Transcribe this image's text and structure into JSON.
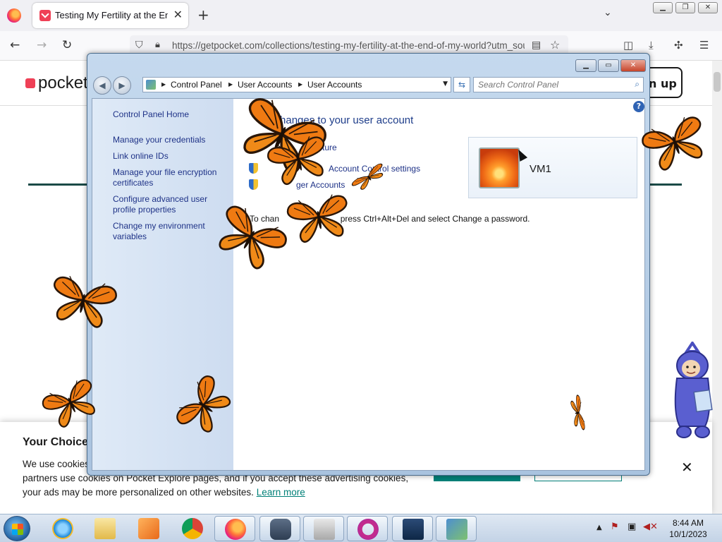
{
  "browser": {
    "tab_title": "Testing My Fertility at the End of My World",
    "tab_close": "✕",
    "new_tab": "+",
    "tab_list": "⌄",
    "url": "https://getpocket.com/collections/testing-my-fertility-at-the-end-of-my-world?utm_source=pocket-newtab",
    "window_min": "▁",
    "window_restore": "❐",
    "window_close": "✕"
  },
  "pocket": {
    "logo_text": "pocket",
    "signup_label": "n up",
    "cookie": {
      "title": "Your Choice",
      "line1": "We use cookies",
      "line2": "partners use cookies on Pocket Explore pages, and if you accept these advertising cookies,",
      "line3": "your ads may be more personalized on other websites.",
      "learn_more": "Learn more",
      "close": "✕"
    }
  },
  "control_panel": {
    "breadcrumbs": [
      "Control Panel",
      "User Accounts",
      "User Accounts"
    ],
    "search_placeholder": "Search Control Panel",
    "sidebar": [
      {
        "label": "Control Panel Home"
      },
      {
        "label": "Manage your credentials"
      },
      {
        "label": "Link online IDs"
      },
      {
        "label": "Manage your file encryption certificates"
      },
      {
        "label": "Configure advanced user profile properties"
      },
      {
        "label": "Change my environment variables"
      }
    ],
    "title": "e changes to your user account",
    "tasks": [
      {
        "label": "cture"
      },
      {
        "label": "Account Control settings"
      },
      {
        "label": "ger Accounts"
      }
    ],
    "password_note": "To chan                          press Ctrl+Alt+Del and select Change a password.",
    "user_name": "VM1",
    "help": "?"
  },
  "taskbar": {
    "time": "8:44 AM",
    "date": "10/1/2023"
  }
}
